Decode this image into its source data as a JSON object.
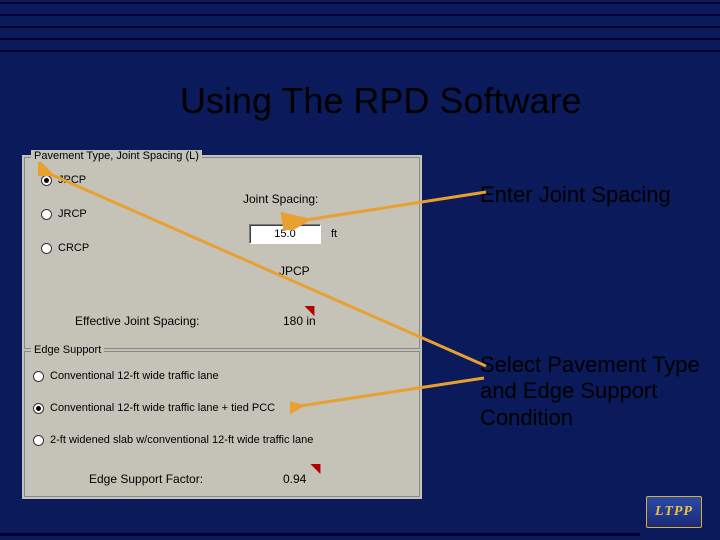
{
  "title": "Using The RPD Software",
  "annotations": {
    "enter_js": "Enter Joint Spacing",
    "select_pt": "Select Pavement Type and Edge Support Condition"
  },
  "panel1": {
    "legend": "Pavement Type, Joint Spacing (L)",
    "options": [
      "JPCP",
      "JRCP",
      "CRCP"
    ],
    "selected": "JPCP",
    "joint_spacing_label": "Joint Spacing:",
    "joint_spacing_value": "15.0",
    "joint_spacing_unit": "ft",
    "type_echo": "JPCP",
    "effective_label": "Effective Joint Spacing:",
    "effective_value": "180",
    "effective_unit": "in"
  },
  "panel2": {
    "legend": "Edge Support",
    "options": [
      "Conventional 12-ft wide traffic lane",
      "Conventional 12-ft wide traffic lane + tied PCC",
      "2-ft widened slab w/conventional 12-ft wide traffic lane"
    ],
    "selected_index": 1,
    "esf_label": "Edge Support Factor:",
    "esf_value": "0.94"
  },
  "logo": "LTPP"
}
